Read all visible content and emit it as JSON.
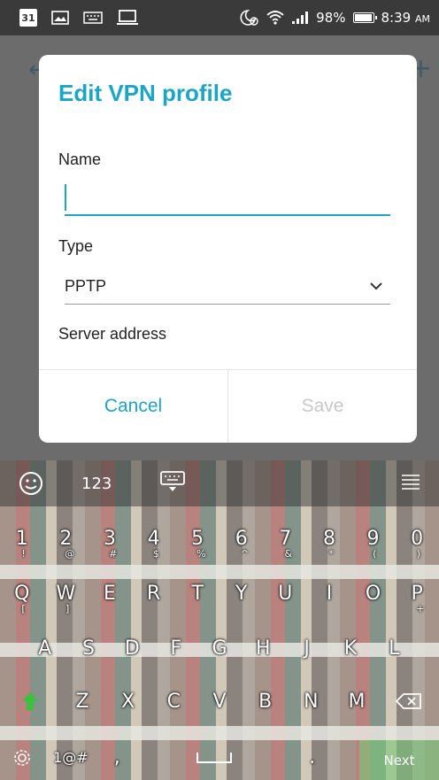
{
  "status_bar": {
    "calendar_day": "31",
    "battery": "98%",
    "battery_level": 0.98,
    "time": "8:39",
    "ampm": "AM"
  },
  "dialog": {
    "title": "Edit VPN profile",
    "name_label": "Name",
    "name_value": "",
    "type_label": "Type",
    "type_value": "PPTP",
    "server_label": "Server address",
    "cancel": "Cancel",
    "save": "Save"
  },
  "keyboard": {
    "top": {
      "num": "123"
    },
    "numbers": [
      {
        "k": "1",
        "s": "!"
      },
      {
        "k": "2",
        "s": "@"
      },
      {
        "k": "3",
        "s": "#"
      },
      {
        "k": "4",
        "s": "$"
      },
      {
        "k": "5",
        "s": "%"
      },
      {
        "k": "6",
        "s": "^"
      },
      {
        "k": "7",
        "s": "&"
      },
      {
        "k": "8",
        "s": "*"
      },
      {
        "k": "9",
        "s": "("
      },
      {
        "k": "0",
        "s": ")"
      }
    ],
    "row1": [
      {
        "k": "Q",
        "s": "["
      },
      {
        "k": "W",
        "s": "]"
      },
      {
        "k": "E",
        "s": ""
      },
      {
        "k": "R",
        "s": ""
      },
      {
        "k": "T",
        "s": ""
      },
      {
        "k": "Y",
        "s": ""
      },
      {
        "k": "U",
        "s": ""
      },
      {
        "k": "I",
        "s": ""
      },
      {
        "k": "O",
        "s": ""
      },
      {
        "k": "P",
        "s": "+"
      }
    ],
    "row2": [
      "A",
      "S",
      "D",
      "F",
      "G",
      "H",
      "J",
      "K",
      "L"
    ],
    "row3": [
      "Z",
      "X",
      "C",
      "V",
      "B",
      "N",
      "M"
    ],
    "symbols": "1@#",
    "comma": ",",
    "period": ".",
    "next": "Next"
  },
  "colors": {
    "accent": "#1aa6c9",
    "disabled": "#c8c8c8",
    "next_key": "#78c878"
  }
}
